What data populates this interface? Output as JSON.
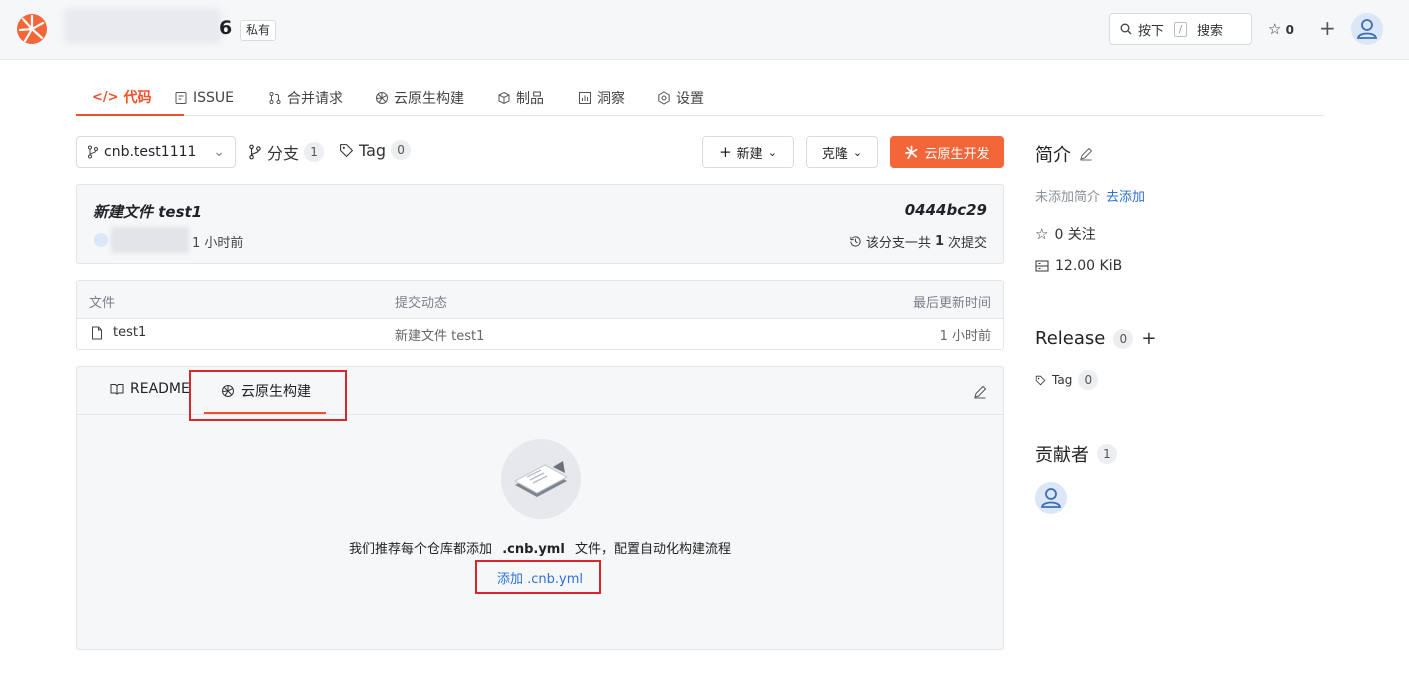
{
  "header": {
    "repo_suffix": "6",
    "private_label": "私有",
    "search_key_label": "按下",
    "search_key": "/",
    "search_label": "搜索",
    "star_count": "0"
  },
  "tabs": [
    {
      "label": "代码",
      "icon": "code-icon"
    },
    {
      "label": "ISSUE",
      "icon": "issue-icon"
    },
    {
      "label": "合并请求",
      "icon": "merge-request-icon"
    },
    {
      "label": "云原生构建",
      "icon": "build-icon"
    },
    {
      "label": "制品",
      "icon": "package-icon"
    },
    {
      "label": "洞察",
      "icon": "insights-icon"
    },
    {
      "label": "设置",
      "icon": "settings-icon"
    }
  ],
  "branch": {
    "current": "cnb.test1111",
    "branches_label": "分支",
    "branches_count": "1",
    "tags_label": "Tag",
    "tags_count": "0"
  },
  "actions": {
    "new_label": "新建",
    "clone_label": "克隆",
    "cloud_dev_label": "云原生开发"
  },
  "commit": {
    "message": "新建文件 test1",
    "hash": "0444bc29",
    "time": "1 小时前",
    "count_prefix": "该分支一共",
    "count": "1",
    "count_suffix": "次提交"
  },
  "files": {
    "columns": [
      "文件",
      "提交动态",
      "最后更新时间"
    ],
    "rows": [
      {
        "name": "test1",
        "commit": "新建文件 test1",
        "updated": "1 小时前"
      }
    ]
  },
  "panel": {
    "tab_readme": "README",
    "tab_build": "云原生构建",
    "empty_prefix": "我们推荐每个仓库都添加",
    "empty_file": ".cnb.yml",
    "empty_suffix": "文件，配置自动化构建流程",
    "add_link": "添加 .cnb.yml"
  },
  "sidebar": {
    "intro_title": "简介",
    "intro_empty": "未添加简介",
    "intro_add": "去添加",
    "watch": "0 关注",
    "size": "12.00 KiB",
    "release_title": "Release",
    "release_count": "0",
    "tag_label": "Tag",
    "tag_count": "0",
    "contributors_title": "贡献者",
    "contributors_count": "1"
  },
  "colors": {
    "accent": "#f2502d",
    "link": "#2c6fd6",
    "highlight_box": "#d9252b"
  }
}
